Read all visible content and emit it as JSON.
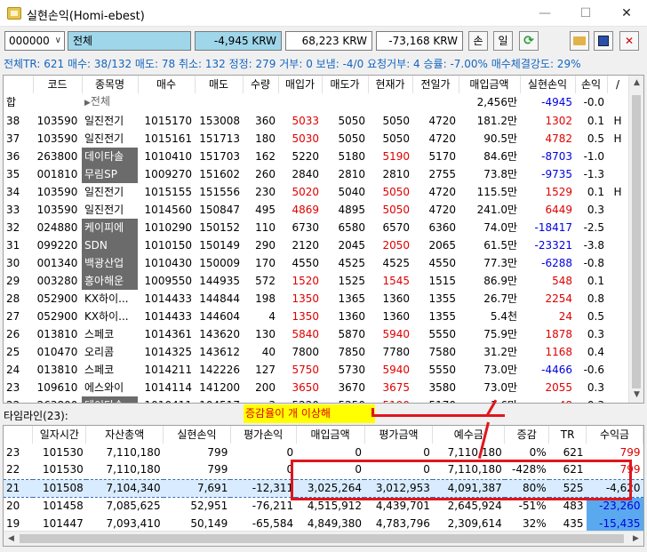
{
  "window": {
    "title": "실현손익(Homi-ebest)",
    "min": "—",
    "max": "☐",
    "close": "✕"
  },
  "toolbar": {
    "code": "000000",
    "name": "전체",
    "pl": "-4,945 KRW",
    "amount1": "68,223 KRW",
    "amount2": "-73,168 KRW",
    "sell": "손",
    "day": "일"
  },
  "summary": "전체TR: 621 매수: 38/132 매도: 78 취소: 132 정정: 279 거부: 0 보냄: -4/0 요청거부: 4 승률: -7.00% 매수체결강도: 29%",
  "colors": {
    "red": "#e00000",
    "blue": "#0000e0",
    "highlight": "#6b6b6b",
    "annotation": "#e0161d",
    "note_bg": "#ffff00"
  },
  "grid": {
    "headers": [
      "코드",
      "종목명",
      "매수",
      "매도",
      "수량",
      "매입가",
      "매도가",
      "현재가",
      "전일가",
      "매입금액",
      "실현손익",
      "손익",
      "/"
    ],
    "total": {
      "label": "합",
      "name": "전체",
      "amount": "2,456만",
      "pl": "-4945",
      "rate": "-0.0"
    },
    "rows": [
      {
        "no": "38",
        "code": "103590",
        "name": "일진전기",
        "buy": "1015170",
        "sell": "153008",
        "qty": "360",
        "bp": "5033",
        "sp": "5050",
        "cur": "5050",
        "prev": "4720",
        "amt": "181.2만",
        "pl": "1302",
        "rate": "0.1",
        "flag": "H",
        "hl": false,
        "bpc": "red",
        "curc": "",
        "plc": "red"
      },
      {
        "no": "37",
        "code": "103590",
        "name": "일진전기",
        "buy": "1015161",
        "sell": "151713",
        "qty": "180",
        "bp": "5030",
        "sp": "5050",
        "cur": "5050",
        "prev": "4720",
        "amt": "90.5만",
        "pl": "4782",
        "rate": "0.5",
        "flag": "H",
        "hl": false,
        "bpc": "red",
        "curc": "",
        "plc": "red"
      },
      {
        "no": "36",
        "code": "263800",
        "name": "데이타솔",
        "buy": "1010410",
        "sell": "151703",
        "qty": "162",
        "bp": "5220",
        "sp": "5180",
        "cur": "5190",
        "prev": "5170",
        "amt": "84.6만",
        "pl": "-8703",
        "rate": "-1.0",
        "flag": "",
        "hl": true,
        "bpc": "",
        "curc": "red",
        "plc": "blue"
      },
      {
        "no": "35",
        "code": "001810",
        "name": "무림SP",
        "buy": "1009270",
        "sell": "151602",
        "qty": "260",
        "bp": "2840",
        "sp": "2810",
        "cur": "2810",
        "prev": "2755",
        "amt": "73.8만",
        "pl": "-9735",
        "rate": "-1.3",
        "flag": "",
        "hl": true,
        "bpc": "",
        "curc": "",
        "plc": "blue"
      },
      {
        "no": "34",
        "code": "103590",
        "name": "일진전기",
        "buy": "1015155",
        "sell": "151556",
        "qty": "230",
        "bp": "5020",
        "sp": "5040",
        "cur": "5050",
        "prev": "4720",
        "amt": "115.5만",
        "pl": "1529",
        "rate": "0.1",
        "flag": "H",
        "hl": false,
        "bpc": "red",
        "curc": "red",
        "plc": "red"
      },
      {
        "no": "33",
        "code": "103590",
        "name": "일진전기",
        "buy": "1014560",
        "sell": "150847",
        "qty": "495",
        "bp": "4869",
        "sp": "4895",
        "cur": "5050",
        "prev": "4720",
        "amt": "241.0만",
        "pl": "6449",
        "rate": "0.3",
        "flag": "",
        "hl": false,
        "bpc": "red",
        "curc": "red",
        "plc": "red"
      },
      {
        "no": "32",
        "code": "024880",
        "name": "케이피에",
        "buy": "1010290",
        "sell": "150152",
        "qty": "110",
        "bp": "6730",
        "sp": "6580",
        "cur": "6570",
        "prev": "6360",
        "amt": "74.0만",
        "pl": "-18417",
        "rate": "-2.5",
        "flag": "",
        "hl": true,
        "bpc": "",
        "curc": "",
        "plc": "blue"
      },
      {
        "no": "31",
        "code": "099220",
        "name": "SDN",
        "buy": "1010150",
        "sell": "150149",
        "qty": "290",
        "bp": "2120",
        "sp": "2045",
        "cur": "2050",
        "prev": "2065",
        "amt": "61.5만",
        "pl": "-23321",
        "rate": "-3.8",
        "flag": "",
        "hl": true,
        "bpc": "",
        "curc": "red",
        "plc": "blue"
      },
      {
        "no": "30",
        "code": "001340",
        "name": "백광산업",
        "buy": "1010430",
        "sell": "150009",
        "qty": "170",
        "bp": "4550",
        "sp": "4525",
        "cur": "4525",
        "prev": "4550",
        "amt": "77.3만",
        "pl": "-6288",
        "rate": "-0.8",
        "flag": "",
        "hl": true,
        "bpc": "",
        "curc": "",
        "plc": "blue"
      },
      {
        "no": "29",
        "code": "003280",
        "name": "흥아해운",
        "buy": "1009550",
        "sell": "144935",
        "qty": "572",
        "bp": "1520",
        "sp": "1525",
        "cur": "1545",
        "prev": "1515",
        "amt": "86.9만",
        "pl": "548",
        "rate": "0.1",
        "flag": "",
        "hl": true,
        "bpc": "red",
        "curc": "red",
        "plc": "red"
      },
      {
        "no": "28",
        "code": "052900",
        "name": "KX하이...",
        "buy": "1014433",
        "sell": "144844",
        "qty": "198",
        "bp": "1350",
        "sp": "1365",
        "cur": "1360",
        "prev": "1355",
        "amt": "26.7만",
        "pl": "2254",
        "rate": "0.8",
        "flag": "",
        "hl": false,
        "bpc": "red",
        "curc": "",
        "plc": "red"
      },
      {
        "no": "27",
        "code": "052900",
        "name": "KX하이...",
        "buy": "1014433",
        "sell": "144604",
        "qty": "4",
        "bp": "1350",
        "sp": "1360",
        "cur": "1360",
        "prev": "1355",
        "amt": "5.4천",
        "pl": "24",
        "rate": "0.5",
        "flag": "",
        "hl": false,
        "bpc": "red",
        "curc": "",
        "plc": "red"
      },
      {
        "no": "26",
        "code": "013810",
        "name": "스페코",
        "buy": "1014361",
        "sell": "143620",
        "qty": "130",
        "bp": "5840",
        "sp": "5870",
        "cur": "5940",
        "prev": "5550",
        "amt": "75.9만",
        "pl": "1878",
        "rate": "0.3",
        "flag": "",
        "hl": false,
        "bpc": "red",
        "curc": "red",
        "plc": "red"
      },
      {
        "no": "25",
        "code": "010470",
        "name": "오리콤",
        "buy": "1014325",
        "sell": "143612",
        "qty": "40",
        "bp": "7800",
        "sp": "7850",
        "cur": "7780",
        "prev": "7580",
        "amt": "31.2만",
        "pl": "1168",
        "rate": "0.4",
        "flag": "",
        "hl": false,
        "bpc": "",
        "curc": "",
        "plc": "red"
      },
      {
        "no": "24",
        "code": "013810",
        "name": "스페코",
        "buy": "1014211",
        "sell": "142226",
        "qty": "127",
        "bp": "5750",
        "sp": "5730",
        "cur": "5940",
        "prev": "5550",
        "amt": "73.0만",
        "pl": "-4466",
        "rate": "-0.6",
        "flag": "",
        "hl": false,
        "bpc": "red",
        "curc": "red",
        "plc": "blue"
      },
      {
        "no": "23",
        "code": "109610",
        "name": "에스와이",
        "buy": "1014114",
        "sell": "141200",
        "qty": "200",
        "bp": "3650",
        "sp": "3670",
        "cur": "3675",
        "prev": "3580",
        "amt": "73.0만",
        "pl": "2055",
        "rate": "0.3",
        "flag": "",
        "hl": false,
        "bpc": "red",
        "curc": "red",
        "plc": "red"
      },
      {
        "no": "22",
        "code": "263800",
        "name": "데이타솔",
        "buy": "1010411",
        "sell": "104517",
        "qty": "3",
        "bp": "5220",
        "sp": "5250",
        "cur": "5190",
        "prev": "5170",
        "amt": "1.6만",
        "pl": "48",
        "rate": "0.3",
        "flag": "",
        "hl": true,
        "bpc": "",
        "curc": "red",
        "plc": "red"
      }
    ]
  },
  "timeline": {
    "label": "타임라인(23):",
    "note": "증감율이 개      이상해",
    "headers": [
      "일자시간",
      "자산총액",
      "실현손익",
      "평가손익",
      "매입금액",
      "평가금액",
      "예수금",
      "증감",
      "TR",
      "수익금"
    ],
    "rows": [
      {
        "no": "23",
        "time": "101530",
        "total": "7,110,180",
        "pl": "799",
        "eval": "0",
        "buyamt": "0",
        "evalamt": "0",
        "cash": "7,110,180",
        "chg": "0%",
        "tr": "621",
        "profit": "799",
        "sel": false,
        "profitc": "red",
        "pbg": false
      },
      {
        "no": "22",
        "time": "101530",
        "total": "7,110,180",
        "pl": "799",
        "eval": "0",
        "buyamt": "0",
        "evalamt": "0",
        "cash": "7,110,180",
        "chg": "-428%",
        "tr": "621",
        "profit": "799",
        "sel": false,
        "profitc": "red",
        "pbg": false
      },
      {
        "no": "21",
        "time": "101508",
        "total": "7,104,340",
        "pl": "7,691",
        "eval": "-12,311",
        "buyamt": "3,025,264",
        "evalamt": "3,012,953",
        "cash": "4,091,387",
        "chg": "80%",
        "tr": "525",
        "profit": "-4,620",
        "sel": true,
        "profitc": "",
        "pbg": false
      },
      {
        "no": "20",
        "time": "101458",
        "total": "7,085,625",
        "pl": "52,951",
        "eval": "-76,211",
        "buyamt": "4,515,912",
        "evalamt": "4,439,701",
        "cash": "2,645,924",
        "chg": "-51%",
        "tr": "483",
        "profit": "-23,260",
        "sel": false,
        "profitc": "blue",
        "pbg": true
      },
      {
        "no": "19",
        "time": "101447",
        "total": "7,093,410",
        "pl": "50,149",
        "eval": "-65,584",
        "buyamt": "4,849,380",
        "evalamt": "4,783,796",
        "cash": "2,309,614",
        "chg": "32%",
        "tr": "435",
        "profit": "-15,435",
        "sel": false,
        "profitc": "blue",
        "pbg": true
      }
    ]
  }
}
